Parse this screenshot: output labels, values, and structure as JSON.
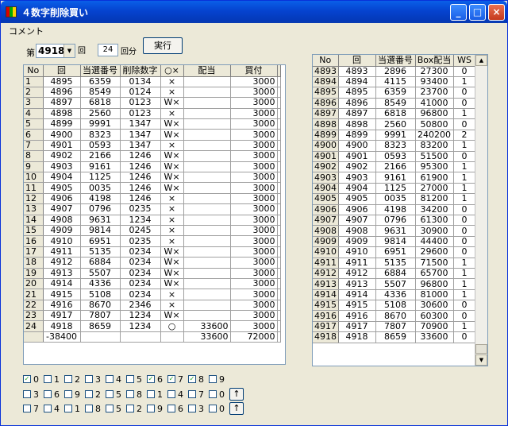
{
  "window": {
    "title": "４数字削除買い",
    "minimize": "_",
    "maximize": "□",
    "close": "×"
  },
  "menu": {
    "comment": "コメント"
  },
  "controls": {
    "dai_label": "第",
    "draw_value": "4918",
    "kai_label": "回",
    "count_value": "24",
    "kaibun_label": "回分",
    "run_button": "実行"
  },
  "left_table": {
    "columns": [
      "No",
      "回",
      "当選番号",
      "削除数字",
      "○×",
      "配当",
      "買付"
    ],
    "rows": [
      [
        "1",
        "4895",
        "6359",
        "0134",
        "×",
        "",
        "3000"
      ],
      [
        "2",
        "4896",
        "8549",
        "0124",
        "×",
        "",
        "3000"
      ],
      [
        "3",
        "4897",
        "6818",
        "0123",
        "W×",
        "",
        "3000"
      ],
      [
        "4",
        "4898",
        "2560",
        "0123",
        "×",
        "",
        "3000"
      ],
      [
        "5",
        "4899",
        "9991",
        "1347",
        "W×",
        "",
        "3000"
      ],
      [
        "6",
        "4900",
        "8323",
        "1347",
        "W×",
        "",
        "3000"
      ],
      [
        "7",
        "4901",
        "0593",
        "1347",
        "×",
        "",
        "3000"
      ],
      [
        "8",
        "4902",
        "2166",
        "1246",
        "W×",
        "",
        "3000"
      ],
      [
        "9",
        "4903",
        "9161",
        "1246",
        "W×",
        "",
        "3000"
      ],
      [
        "10",
        "4904",
        "1125",
        "1246",
        "W×",
        "",
        "3000"
      ],
      [
        "11",
        "4905",
        "0035",
        "1246",
        "W×",
        "",
        "3000"
      ],
      [
        "12",
        "4906",
        "4198",
        "1246",
        "×",
        "",
        "3000"
      ],
      [
        "13",
        "4907",
        "0796",
        "0235",
        "×",
        "",
        "3000"
      ],
      [
        "14",
        "4908",
        "9631",
        "1234",
        "×",
        "",
        "3000"
      ],
      [
        "15",
        "4909",
        "9814",
        "0245",
        "×",
        "",
        "3000"
      ],
      [
        "16",
        "4910",
        "6951",
        "0235",
        "×",
        "",
        "3000"
      ],
      [
        "17",
        "4911",
        "5135",
        "0234",
        "W×",
        "",
        "3000"
      ],
      [
        "18",
        "4912",
        "6884",
        "0234",
        "W×",
        "",
        "3000"
      ],
      [
        "19",
        "4913",
        "5507",
        "0234",
        "W×",
        "",
        "3000"
      ],
      [
        "20",
        "4914",
        "4336",
        "0234",
        "W×",
        "",
        "3000"
      ],
      [
        "21",
        "4915",
        "5108",
        "0234",
        "×",
        "",
        "3000"
      ],
      [
        "22",
        "4916",
        "8670",
        "2346",
        "×",
        "",
        "3000"
      ],
      [
        "23",
        "4917",
        "7807",
        "1234",
        "W×",
        "",
        "3000"
      ],
      [
        "24",
        "4918",
        "8659",
        "1234",
        "○",
        "33600",
        "3000"
      ]
    ],
    "total": [
      "",
      "-38400",
      "",
      "",
      "",
      "33600",
      "72000"
    ]
  },
  "right_table": {
    "columns": [
      "No",
      "回",
      "当選番号",
      "Box配当",
      "WS"
    ],
    "rows": [
      [
        "4893",
        "4893",
        "2896",
        "27300",
        "0"
      ],
      [
        "4894",
        "4894",
        "4115",
        "93400",
        "1"
      ],
      [
        "4895",
        "4895",
        "6359",
        "23700",
        "0"
      ],
      [
        "4896",
        "4896",
        "8549",
        "41000",
        "0"
      ],
      [
        "4897",
        "4897",
        "6818",
        "96800",
        "1"
      ],
      [
        "4898",
        "4898",
        "2560",
        "50800",
        "0"
      ],
      [
        "4899",
        "4899",
        "9991",
        "240200",
        "2"
      ],
      [
        "4900",
        "4900",
        "8323",
        "83200",
        "1"
      ],
      [
        "4901",
        "4901",
        "0593",
        "51500",
        "0"
      ],
      [
        "4902",
        "4902",
        "2166",
        "95300",
        "1"
      ],
      [
        "4903",
        "4903",
        "9161",
        "61900",
        "1"
      ],
      [
        "4904",
        "4904",
        "1125",
        "27000",
        "1"
      ],
      [
        "4905",
        "4905",
        "0035",
        "81200",
        "1"
      ],
      [
        "4906",
        "4906",
        "4198",
        "34200",
        "0"
      ],
      [
        "4907",
        "4907",
        "0796",
        "61300",
        "0"
      ],
      [
        "4908",
        "4908",
        "9631",
        "30900",
        "0"
      ],
      [
        "4909",
        "4909",
        "9814",
        "44400",
        "0"
      ],
      [
        "4910",
        "4910",
        "6951",
        "29600",
        "0"
      ],
      [
        "4911",
        "4911",
        "5135",
        "71500",
        "1"
      ],
      [
        "4912",
        "4912",
        "6884",
        "65700",
        "1"
      ],
      [
        "4913",
        "4913",
        "5507",
        "96800",
        "1"
      ],
      [
        "4914",
        "4914",
        "4336",
        "81000",
        "1"
      ],
      [
        "4915",
        "4915",
        "5108",
        "30600",
        "0"
      ],
      [
        "4916",
        "4916",
        "8670",
        "60300",
        "0"
      ],
      [
        "4917",
        "4917",
        "7807",
        "70900",
        "1"
      ],
      [
        "4918",
        "4918",
        "8659",
        "33600",
        "0"
      ]
    ]
  },
  "checkbox_rows": [
    {
      "items": [
        {
          "n": "0",
          "checked": true
        },
        {
          "n": "1",
          "checked": false
        },
        {
          "n": "2",
          "checked": false
        },
        {
          "n": "3",
          "checked": false
        },
        {
          "n": "4",
          "checked": false
        },
        {
          "n": "5",
          "checked": false
        },
        {
          "n": "6",
          "checked": true
        },
        {
          "n": "7",
          "checked": true
        },
        {
          "n": "8",
          "checked": true
        },
        {
          "n": "9",
          "checked": false
        }
      ],
      "button": ""
    },
    {
      "items": [
        {
          "n": "3",
          "checked": false
        },
        {
          "n": "6",
          "checked": false
        },
        {
          "n": "9",
          "checked": false
        },
        {
          "n": "2",
          "checked": false
        },
        {
          "n": "5",
          "checked": false
        },
        {
          "n": "8",
          "checked": false
        },
        {
          "n": "1",
          "checked": false
        },
        {
          "n": "4",
          "checked": false
        },
        {
          "n": "7",
          "checked": false
        },
        {
          "n": "0",
          "checked": false
        }
      ],
      "button": "↑"
    },
    {
      "items": [
        {
          "n": "7",
          "checked": false
        },
        {
          "n": "4",
          "checked": false
        },
        {
          "n": "1",
          "checked": false
        },
        {
          "n": "8",
          "checked": false
        },
        {
          "n": "5",
          "checked": false
        },
        {
          "n": "2",
          "checked": false
        },
        {
          "n": "9",
          "checked": false
        },
        {
          "n": "6",
          "checked": false
        },
        {
          "n": "3",
          "checked": false
        },
        {
          "n": "0",
          "checked": false
        }
      ],
      "button": "↑"
    }
  ],
  "colors": {
    "titlebar": "#0543cf",
    "window_bg": "#ece9d8",
    "grid_header": "#ece9d8",
    "checkmark": "#21a121"
  }
}
